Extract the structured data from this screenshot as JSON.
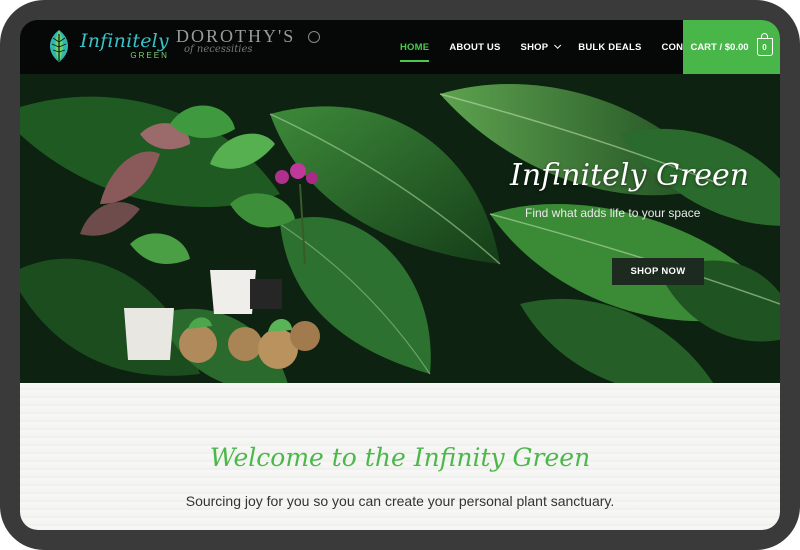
{
  "brand": {
    "logo_script": "Infinitely",
    "logo_sub": "GREEN",
    "partner_name": "DOROTHY'S",
    "partner_tag": "of necessities"
  },
  "nav": {
    "items": [
      {
        "label": "HOME",
        "active": true
      },
      {
        "label": "ABOUT US",
        "active": false
      },
      {
        "label": "SHOP",
        "active": false,
        "dropdown": true
      },
      {
        "label": "BULK DEALS",
        "active": false
      },
      {
        "label": "CONTACT",
        "active": false
      }
    ],
    "active_color": "#4cc94c"
  },
  "cart": {
    "label": "CART / $0.00",
    "count": "0",
    "color": "#48b649"
  },
  "hero": {
    "title": "Infinitely Green",
    "subtitle": "Find what adds life to your space",
    "cta": "SHOP NOW"
  },
  "welcome": {
    "title": "Welcome to the Infinity Green",
    "subtitle": "Sourcing joy for you so you can create your personal plant sanctuary."
  },
  "icons": [
    "leaf-logo-icon",
    "chevron-down-icon",
    "cart-icon"
  ]
}
